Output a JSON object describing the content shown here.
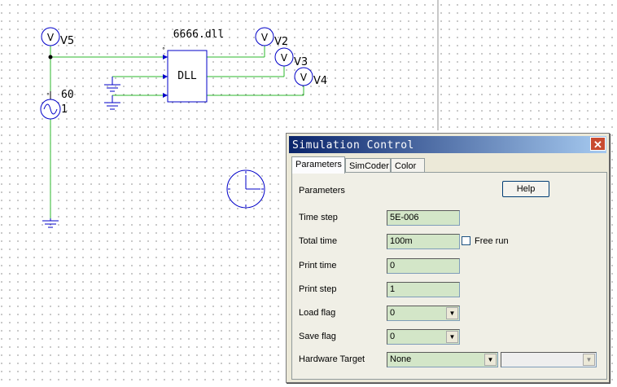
{
  "schematic": {
    "dll_filename": "6666.dll",
    "dll_block_label": "DLL",
    "voltmeters": [
      {
        "label": "V5",
        "glyph": "V"
      },
      {
        "label": "V2",
        "glyph": "V"
      },
      {
        "label": "V3",
        "glyph": "V"
      },
      {
        "label": "V4",
        "glyph": "V"
      }
    ],
    "source": {
      "value": "60",
      "name": "1"
    },
    "wire_color": "#2db82d",
    "component_color": "#0000c8"
  },
  "dialog": {
    "title": "Simulation Control",
    "close_glyph": "✕",
    "tabs": [
      {
        "label": "Parameters",
        "active": true
      },
      {
        "label": "SimCoder",
        "active": false
      },
      {
        "label": "Color",
        "active": false
      }
    ],
    "section_label": "Parameters",
    "help_button": "Help",
    "fields": {
      "time_step": {
        "label": "Time step",
        "value": "5E-006"
      },
      "total_time": {
        "label": "Total time",
        "value": "100m"
      },
      "free_run": {
        "label": "Free run",
        "checked": false
      },
      "print_time": {
        "label": "Print time",
        "value": "0"
      },
      "print_step": {
        "label": "Print step",
        "value": "1"
      },
      "load_flag": {
        "label": "Load flag",
        "value": "0"
      },
      "save_flag": {
        "label": "Save flag",
        "value": "0"
      },
      "hardware_target": {
        "label": "Hardware Target",
        "value": "None",
        "secondary_value": ""
      }
    },
    "field_color": "#d3e6c8",
    "title_color": "#0a246a"
  }
}
